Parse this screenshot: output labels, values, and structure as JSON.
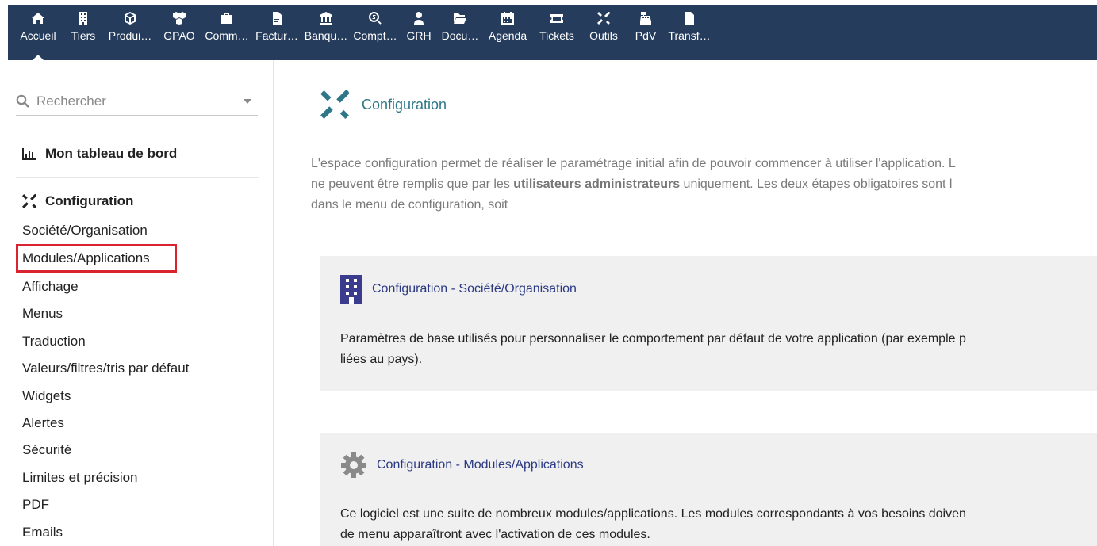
{
  "colors": {
    "topbar_bg": "#263c5c",
    "accent_teal": "#2f7788",
    "card_title": "#2b3a83",
    "highlight": "#d9232e"
  },
  "topnav": [
    {
      "label": "Accueil",
      "icon": "home-icon"
    },
    {
      "label": "Tiers",
      "icon": "building-icon"
    },
    {
      "label": "Produi…",
      "icon": "cube-icon"
    },
    {
      "label": "GPAO",
      "icon": "cubes-icon"
    },
    {
      "label": "Comm…",
      "icon": "briefcase-icon"
    },
    {
      "label": "Factur…",
      "icon": "invoice-icon"
    },
    {
      "label": "Banqu…",
      "icon": "bank-icon"
    },
    {
      "label": "Compt…",
      "icon": "search-dollar-icon"
    },
    {
      "label": "GRH",
      "icon": "user-tie-icon"
    },
    {
      "label": "Docu…",
      "icon": "folder-open-icon"
    },
    {
      "label": "Agenda",
      "icon": "calendar-icon"
    },
    {
      "label": "Tickets",
      "icon": "ticket-icon"
    },
    {
      "label": "Outils",
      "icon": "tools-icon"
    },
    {
      "label": "PdV",
      "icon": "cash-register-icon"
    },
    {
      "label": "Transf…",
      "icon": "file-icon"
    }
  ],
  "sidebar": {
    "search_placeholder": "Rechercher",
    "dashboard_label": "Mon tableau de bord",
    "config_label": "Configuration",
    "items": [
      {
        "label": "Société/Organisation"
      },
      {
        "label": "Modules/Applications"
      },
      {
        "label": "Affichage"
      },
      {
        "label": "Menus"
      },
      {
        "label": "Traduction"
      },
      {
        "label": "Valeurs/filtres/tris par défaut"
      },
      {
        "label": "Widgets"
      },
      {
        "label": "Alertes"
      },
      {
        "label": "Sécurité"
      },
      {
        "label": "Limites et précision"
      },
      {
        "label": "PDF"
      },
      {
        "label": "Emails"
      }
    ]
  },
  "main": {
    "title": "Configuration",
    "intro_line1": "L'espace configuration permet de réaliser le paramétrage initial afin de pouvoir commencer à utiliser l'application. L",
    "intro_line2_pre": "ne peuvent être remplis que par les ",
    "intro_line2_bold": "utilisateurs administrateurs",
    "intro_line2_post": " uniquement. Les deux étapes obligatoires sont l",
    "intro_line3": "dans le menu de configuration, soit",
    "cards": [
      {
        "title": "Configuration - Société/Organisation",
        "desc_line1": "Paramètres de base utilisés pour personnaliser le comportement par défaut de votre application (par exemple p",
        "desc_line2": "liées au pays)."
      },
      {
        "title": "Configuration - Modules/Applications",
        "desc_line1": "Ce logiciel est une suite de nombreux modules/applications. Les modules correspondants à vos besoins doiven",
        "desc_line2": "de menu apparaîtront avec l'activation de ces modules."
      }
    ]
  }
}
